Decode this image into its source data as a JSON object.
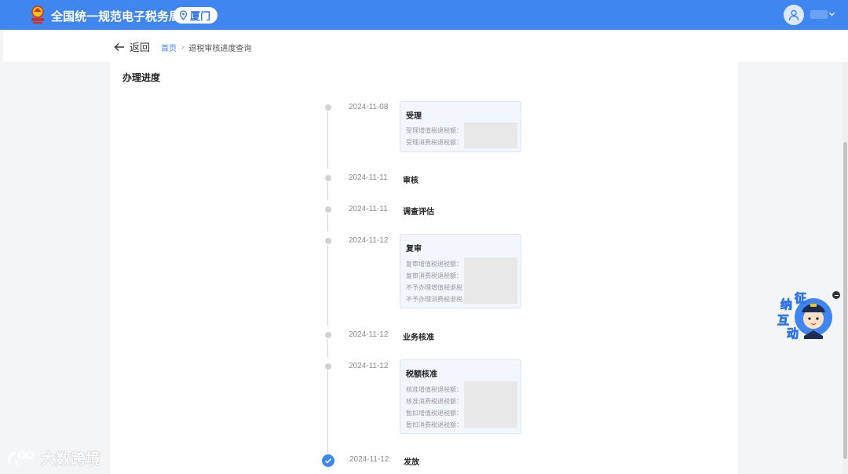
{
  "header": {
    "brand": "全国统一规范电子税务局",
    "city": "厦门"
  },
  "nav": {
    "back_label": "返回",
    "breadcrumb": [
      "首页",
      "退税审核进度查询"
    ],
    "breadcrumb_sep": "›"
  },
  "panel": {
    "title": "办理进度"
  },
  "timeline": [
    {
      "date": "2024-11-08",
      "step": "受理",
      "rows": [
        "受理增值税退税额：",
        "受理消费税退税额："
      ]
    },
    {
      "date": "2024-11-11",
      "step": "审核"
    },
    {
      "date": "2024-11-11",
      "step": "调查评估"
    },
    {
      "date": "2024-11-12",
      "step": "复审",
      "rows": [
        "复审增值税退税额：",
        "复审消费税退税额：",
        "不予办理增值税退税额：",
        "不予办理消费税退税额："
      ]
    },
    {
      "date": "2024-11-12",
      "step": "业务核准"
    },
    {
      "date": "2024-11-12",
      "step": "税额核准",
      "rows": [
        "核准增值税退税额：",
        "核准消费税退税额：",
        "暂扣增值税退税额：",
        "暂扣消费税退税额："
      ]
    },
    {
      "date": "2024-11-12",
      "step": "发放"
    }
  ],
  "helper": {
    "chars": [
      "征",
      "纳",
      "互",
      "动"
    ]
  },
  "watermark": {
    "text": "大数跨境"
  },
  "colors": {
    "primary": "#3f86f1",
    "page_bg": "#f4f5f7",
    "card_bg": "#f2f7fd"
  },
  "icons": [
    "tax-emblem-icon",
    "location-pin-icon",
    "user-avatar-icon",
    "chevron-down-icon",
    "back-arrow-icon",
    "check-icon",
    "helper-mascot-icon",
    "minus-icon"
  ]
}
